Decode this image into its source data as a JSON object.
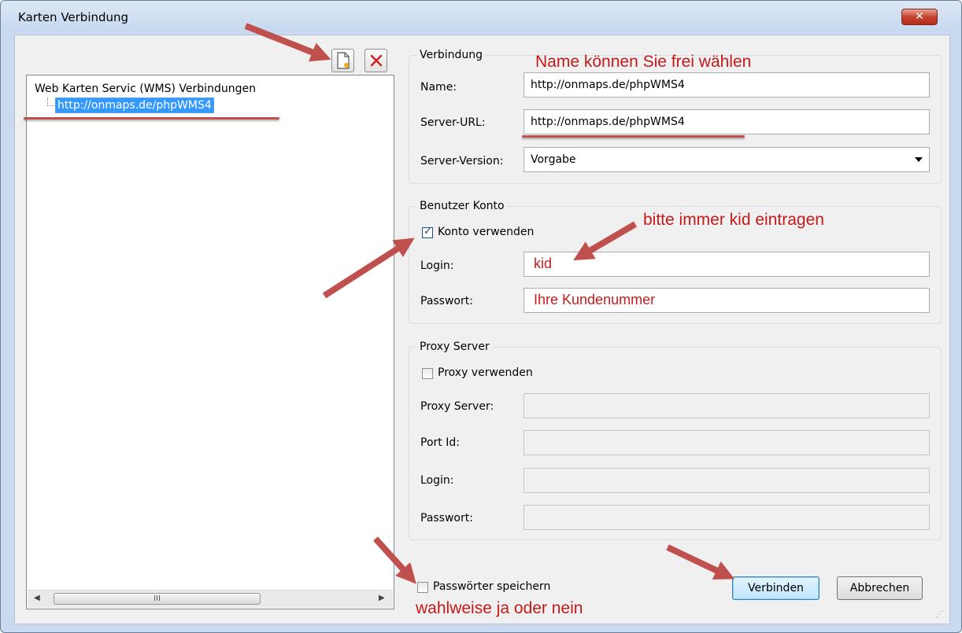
{
  "window": {
    "title": "Karten Verbindung",
    "close_label": "✕"
  },
  "tree": {
    "root_label": "Web Karten Servic (WMS) Verbindungen",
    "items": [
      {
        "label": "http://onmaps.de/phpWMS4"
      }
    ],
    "scroll_grip": "III"
  },
  "toolbar": {
    "new_icon": "new-document-icon",
    "delete_icon": "delete-x-icon"
  },
  "connection": {
    "legend": "Verbindung",
    "name_label": "Name:",
    "name_value": "http://onmaps.de/phpWMS4",
    "url_label": "Server-URL:",
    "url_value": "http://onmaps.de/phpWMS4",
    "version_label": "Server-Version:",
    "version_value": "Vorgabe"
  },
  "account": {
    "legend": "Benutzer Konto",
    "use_label": "Konto verwenden",
    "use_checked": true,
    "login_label": "Login:",
    "login_value": "kid",
    "password_label": "Passwort:",
    "password_value": "Ihre Kundenummer"
  },
  "proxy": {
    "legend": "Proxy Server",
    "use_label": "Proxy verwenden",
    "use_checked": false,
    "server_label": "Proxy Server:",
    "port_label": "Port Id:",
    "login_label": "Login:",
    "password_label": "Passwort:"
  },
  "save_passwords": {
    "label": "Passwörter speichern",
    "checked": false
  },
  "buttons": {
    "connect": "Verbinden",
    "cancel": "Abbrechen"
  },
  "annotations": {
    "name_hint": "Name können Sie frei wählen",
    "login_hint": "bitte immer kid eintragen",
    "save_hint": "wahlweise ja oder nein"
  },
  "colors": {
    "annotation": "#c41a1a",
    "arrow": "#c0504d",
    "selection": "#3399ff"
  }
}
